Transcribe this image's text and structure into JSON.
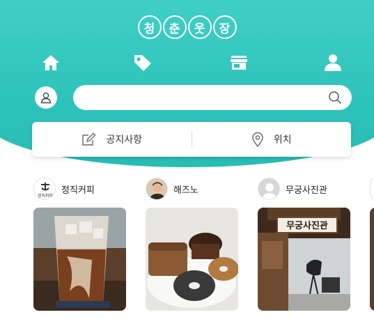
{
  "app": {
    "logo_chars": [
      "청",
      "춘",
      "웃",
      "장"
    ]
  },
  "nav": {
    "items": [
      {
        "icon": "home-icon"
      },
      {
        "icon": "tag-icon"
      },
      {
        "icon": "store-icon"
      },
      {
        "icon": "person-icon"
      }
    ]
  },
  "search": {
    "value": "",
    "placeholder": "",
    "user_icon": "user-outline-icon",
    "search_icon": "search-icon"
  },
  "quick": {
    "notice_label": "공지사항",
    "notice_icon": "edit-icon",
    "location_label": "위치",
    "location_icon": "location-pin-icon"
  },
  "stores": [
    {
      "name": "정직커피",
      "avatar_label": "정직커피"
    },
    {
      "name": "해즈노"
    },
    {
      "name": "무궁사진관",
      "sign_text": "무궁사진관"
    }
  ],
  "colors": {
    "brand": "#2fc4bb",
    "white": "#ffffff",
    "icon_dark": "#1f8a84"
  }
}
